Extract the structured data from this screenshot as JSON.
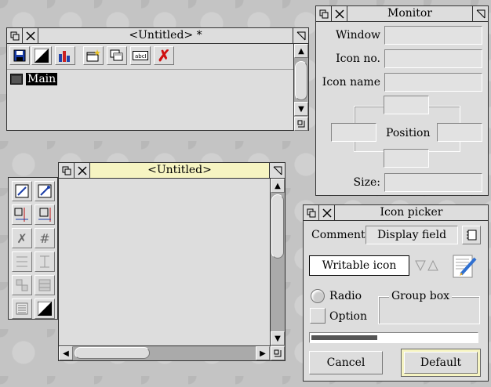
{
  "untitled_top": {
    "title": "<Untitled> *",
    "tree_item": "Main",
    "toolbar": [
      "save-icon",
      "colour-icon",
      "bar-chart-icon",
      "new-window-icon",
      "copy-windows-icon",
      "writable-field-icon",
      "delete-icon"
    ]
  },
  "untitled_bottom": {
    "title": "<Untitled>"
  },
  "monitor": {
    "title": "Monitor",
    "window_label": "Window",
    "icon_no_label": "Icon no.",
    "icon_name_label": "Icon name",
    "position_label": "Position",
    "size_label": "Size:"
  },
  "icon_picker": {
    "title": "Icon picker",
    "comment_label": "Comment",
    "display_field": "Display field",
    "writable_icon": "Writable icon",
    "radio_label": "Radio",
    "option_label": "Option",
    "group_box_label": "Group box",
    "progress": 0.4,
    "cancel_label": "Cancel",
    "default_label": "Default"
  }
}
